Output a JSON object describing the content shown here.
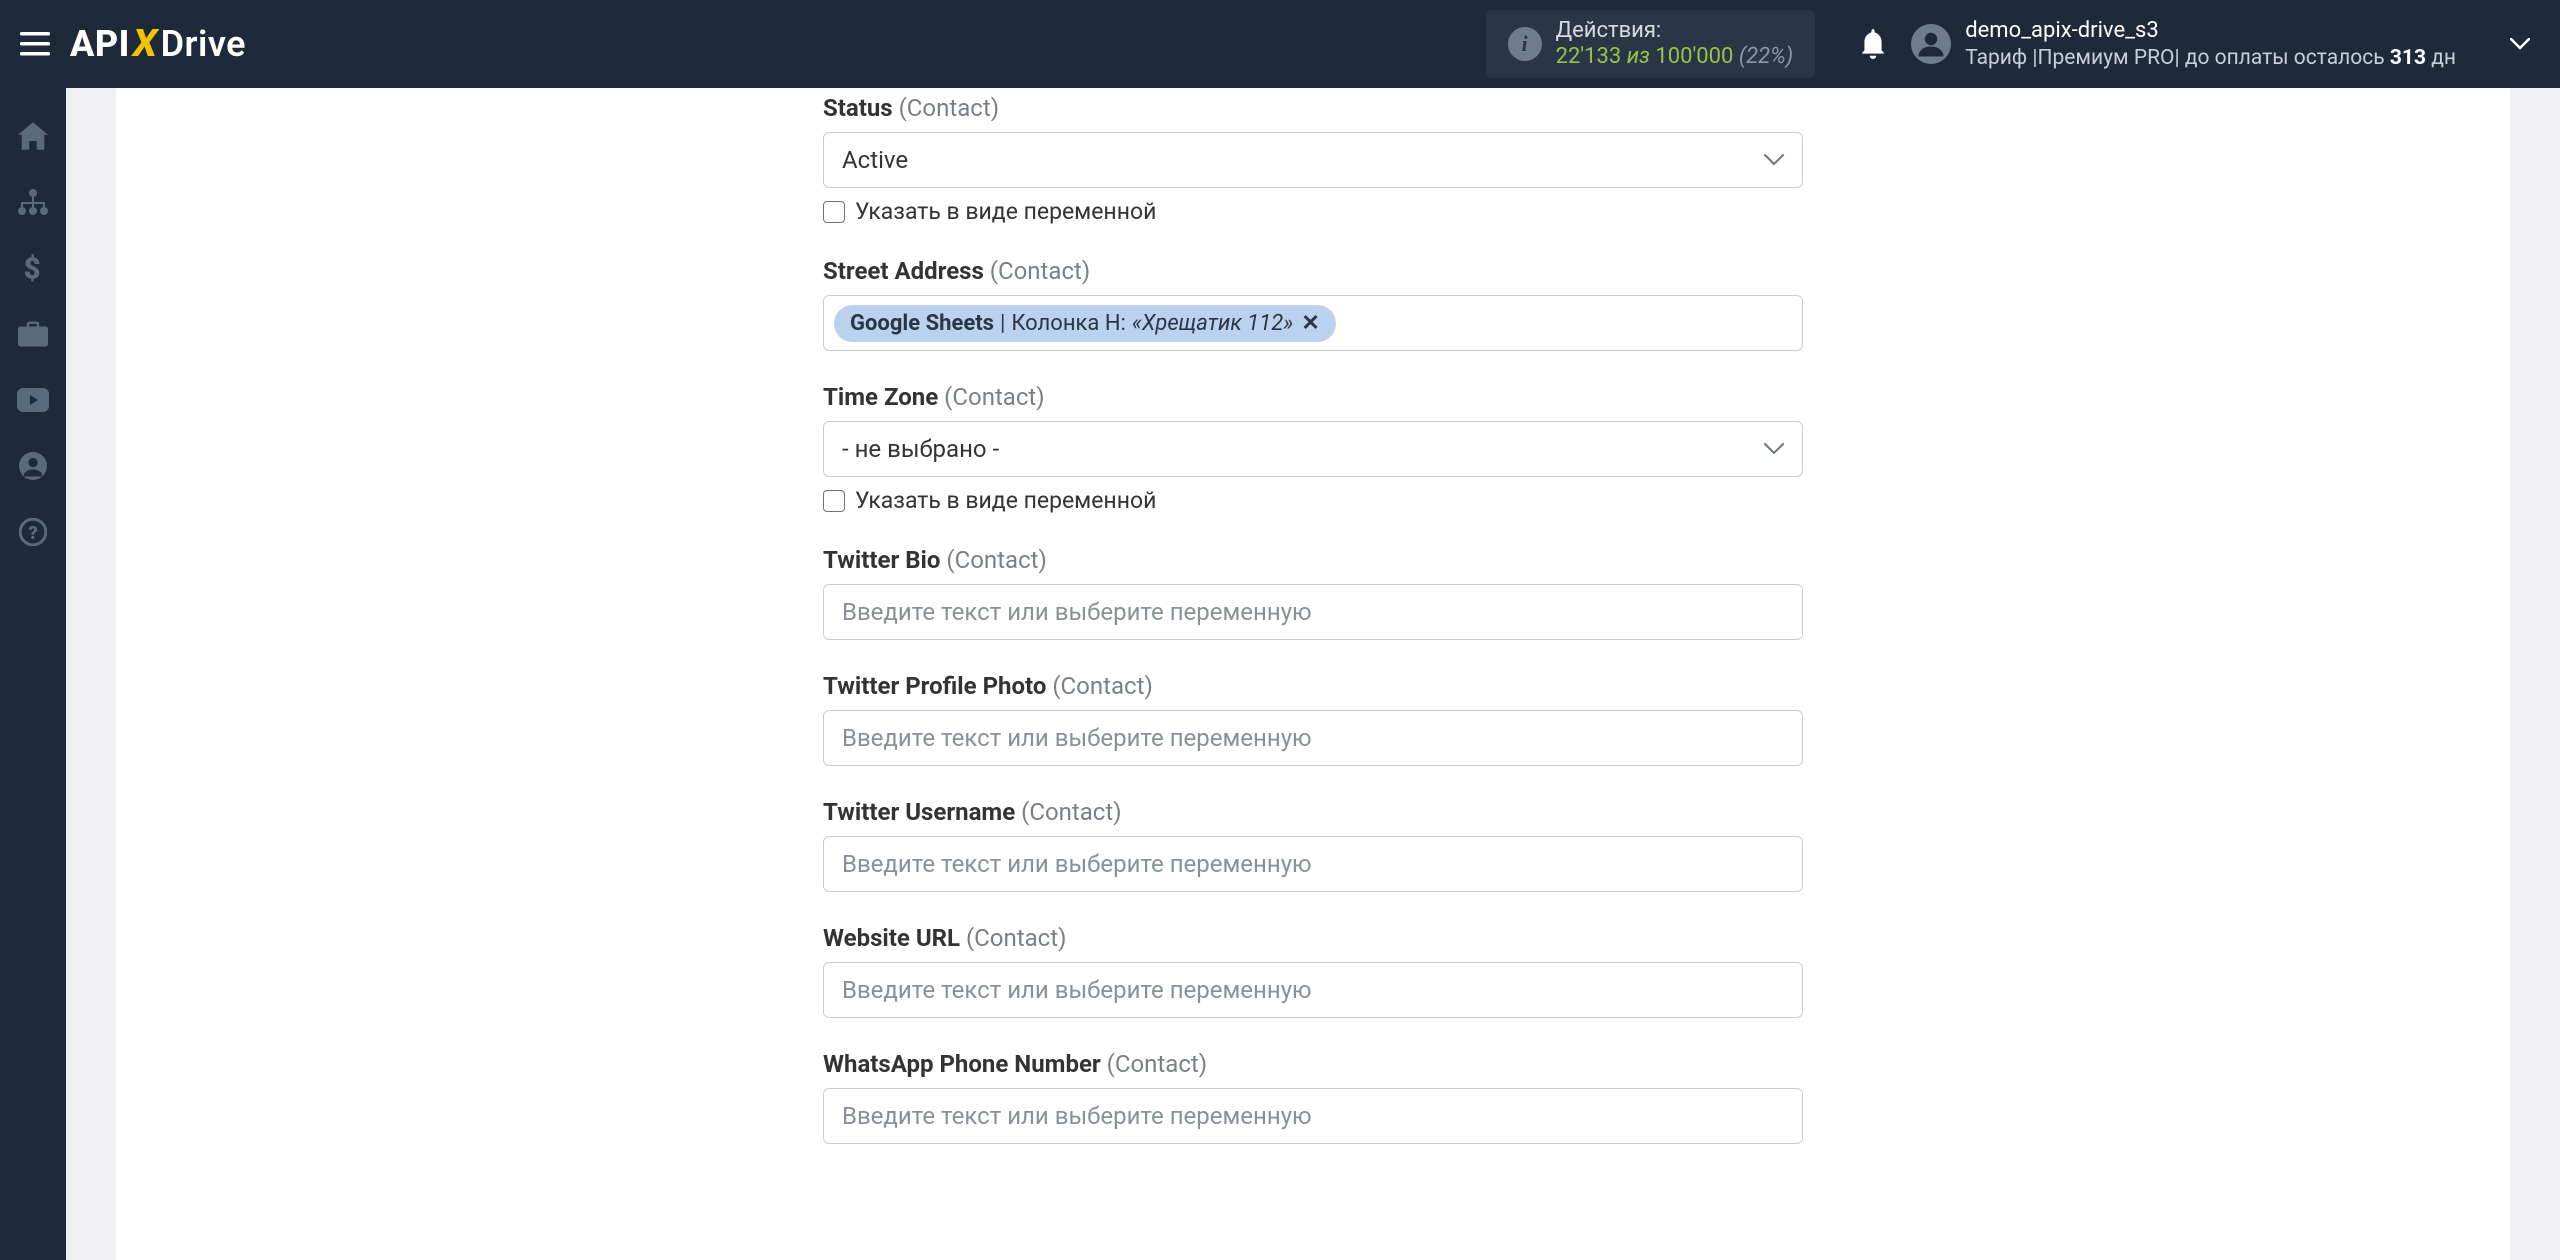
{
  "header": {
    "logo_api": "API",
    "logo_x": "X",
    "logo_drive": "Drive",
    "actions_label": "Действия:",
    "actions_count": "22'133",
    "actions_of": "из",
    "actions_total": "100'000",
    "actions_pct": "(22%)",
    "username": "demo_apix-drive_s3",
    "tariff_prefix": "Тариф |",
    "tariff_name": "Премиум PRO",
    "tariff_sep": "|",
    "tariff_rest1": " до оплаты осталось ",
    "tariff_days": "313",
    "tariff_rest2": " дн"
  },
  "fields": {
    "status": {
      "label_bold": "Status",
      "label_sub": "(Contact)",
      "value": "Active",
      "cb_label": "Указать в виде переменной"
    },
    "street": {
      "label_bold": "Street Address",
      "label_sub": "(Contact)",
      "chip_source": "Google Sheets",
      "chip_sep": " | ",
      "chip_col": "Колонка H: ",
      "chip_value": "«Хрещатик 112»",
      "chip_x": "✕"
    },
    "timezone": {
      "label_bold": "Time Zone",
      "label_sub": "(Contact)",
      "value": "- не выбрано -",
      "cb_label": "Указать в виде переменной"
    },
    "twitter_bio": {
      "label_bold": "Twitter Bio",
      "label_sub": "(Contact)",
      "placeholder": "Введите текст или выберите переменную"
    },
    "twitter_photo": {
      "label_bold": "Twitter Profile Photo",
      "label_sub": "(Contact)",
      "placeholder": "Введите текст или выберите переменную"
    },
    "twitter_username": {
      "label_bold": "Twitter Username",
      "label_sub": "(Contact)",
      "placeholder": "Введите текст или выберите переменную"
    },
    "website": {
      "label_bold": "Website URL",
      "label_sub": "(Contact)",
      "placeholder": "Введите текст или выберите переменную"
    },
    "whatsapp": {
      "label_bold": "WhatsApp Phone Number",
      "label_sub": "(Contact)",
      "placeholder": "Введите текст или выберите переменную"
    }
  }
}
